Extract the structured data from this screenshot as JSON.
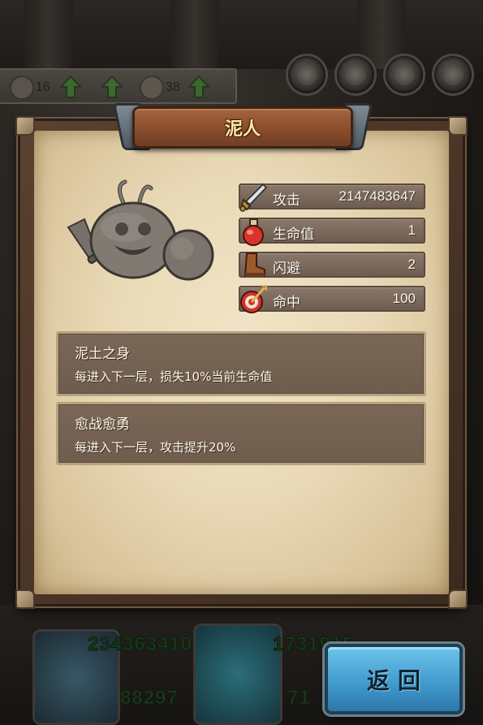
{
  "topbar": {
    "counters": [
      {
        "icon": "horse-icon",
        "value": "16"
      },
      {
        "icon": "gear-icon",
        "value": "38"
      }
    ]
  },
  "hud": {
    "numbers": [
      "234363410",
      "1731915",
      "88297",
      "71"
    ]
  },
  "panel": {
    "title": "泥人",
    "monster_icon": "mud-golem-icon",
    "stats": [
      {
        "icon": "sword-icon",
        "label": "攻击",
        "value": "2147483647"
      },
      {
        "icon": "potion-icon",
        "label": "生命值",
        "value": "1"
      },
      {
        "icon": "boot-icon",
        "label": "闪避",
        "value": "2"
      },
      {
        "icon": "target-icon",
        "label": "命中",
        "value": "100"
      }
    ],
    "skills": [
      {
        "name": "泥土之身",
        "desc": "每进入下一层，损失10%当前生命值"
      },
      {
        "name": "愈战愈勇",
        "desc": "每进入下一层，攻击提升20%"
      }
    ]
  },
  "back_button": {
    "label": "返回"
  },
  "colors": {
    "parchment": "#e9d9b6",
    "stat_bar": "#7b6a5d",
    "back_button": "#4aa6d8",
    "title_text": "#ffe9a6"
  }
}
